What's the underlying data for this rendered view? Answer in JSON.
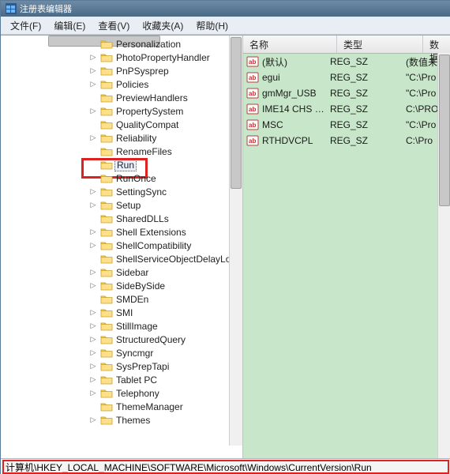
{
  "window": {
    "title": "注册表编辑器"
  },
  "menu": {
    "file": "文件(F)",
    "edit": "编辑(E)",
    "view": "查看(V)",
    "favorites": "收藏夹(A)",
    "help": "帮助(H)"
  },
  "tree": {
    "items": [
      {
        "label": "Personalization",
        "expandable": false
      },
      {
        "label": "PhotoPropertyHandler",
        "expandable": true
      },
      {
        "label": "PnPSysprep",
        "expandable": true
      },
      {
        "label": "Policies",
        "expandable": true
      },
      {
        "label": "PreviewHandlers",
        "expandable": false
      },
      {
        "label": "PropertySystem",
        "expandable": true
      },
      {
        "label": "QualityCompat",
        "expandable": false
      },
      {
        "label": "Reliability",
        "expandable": true
      },
      {
        "label": "RenameFiles",
        "expandable": false
      },
      {
        "label": "Run",
        "expandable": false,
        "highlight": true
      },
      {
        "label": "RunOnce",
        "expandable": false
      },
      {
        "label": "SettingSync",
        "expandable": true
      },
      {
        "label": "Setup",
        "expandable": true
      },
      {
        "label": "SharedDLLs",
        "expandable": false
      },
      {
        "label": "Shell Extensions",
        "expandable": true
      },
      {
        "label": "ShellCompatibility",
        "expandable": true
      },
      {
        "label": "ShellServiceObjectDelayLo",
        "expandable": false
      },
      {
        "label": "Sidebar",
        "expandable": true
      },
      {
        "label": "SideBySide",
        "expandable": true
      },
      {
        "label": "SMDEn",
        "expandable": false
      },
      {
        "label": "SMI",
        "expandable": true
      },
      {
        "label": "StillImage",
        "expandable": true
      },
      {
        "label": "StructuredQuery",
        "expandable": true
      },
      {
        "label": "Syncmgr",
        "expandable": true
      },
      {
        "label": "SysPrepTapi",
        "expandable": true
      },
      {
        "label": "Tablet PC",
        "expandable": true
      },
      {
        "label": "Telephony",
        "expandable": true
      },
      {
        "label": "ThemeManager",
        "expandable": false
      },
      {
        "label": "Themes",
        "expandable": true
      }
    ]
  },
  "values": {
    "headers": {
      "name": "名称",
      "type": "类型",
      "data": "数据"
    },
    "rows": [
      {
        "name": "(默认)",
        "type": "REG_SZ",
        "data": "(数值未"
      },
      {
        "name": "egui",
        "type": "REG_SZ",
        "data": "\"C:\\Pro"
      },
      {
        "name": "gmMgr_USB",
        "type": "REG_SZ",
        "data": "\"C:\\Pro"
      },
      {
        "name": "IME14 CHS Set...",
        "type": "REG_SZ",
        "data": "C:\\PRO"
      },
      {
        "name": "MSC",
        "type": "REG_SZ",
        "data": "\"C:\\Pro"
      },
      {
        "name": "RTHDVCPL",
        "type": "REG_SZ",
        "data": "C:\\Pro"
      }
    ]
  },
  "status": {
    "path": "计算机\\HKEY_LOCAL_MACHINE\\SOFTWARE\\Microsoft\\Windows\\CurrentVersion\\Run"
  },
  "icons": {
    "twisty": "▷"
  }
}
